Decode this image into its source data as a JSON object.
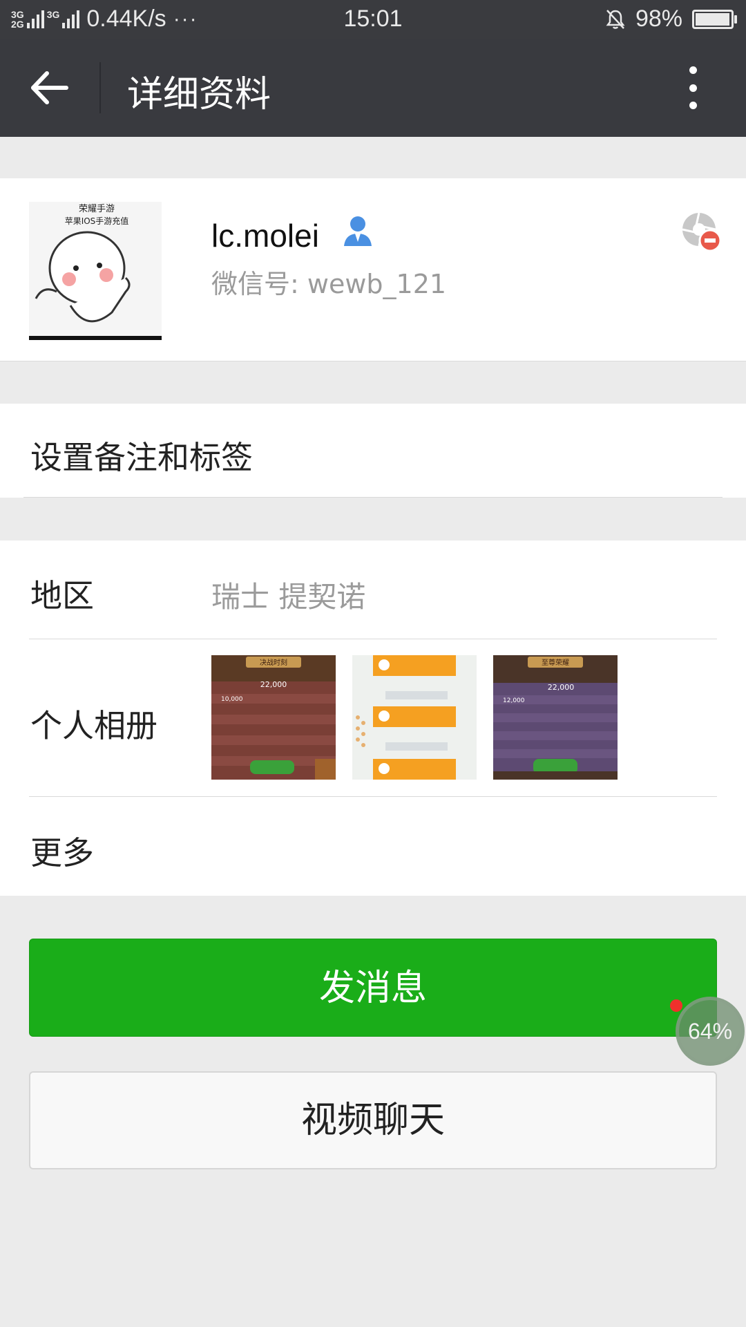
{
  "status_bar": {
    "network_top": "3G",
    "network_bottom": "2G",
    "network_top2": "3G",
    "speed": "0.44K/s",
    "more": "···",
    "time": "15:01",
    "battery_percent": "98%",
    "battery_level": 0.98
  },
  "header": {
    "title": "详细资料",
    "back_icon": "arrow-left-icon",
    "more_icon": "more-vertical-icon"
  },
  "profile": {
    "name": "lc.molei",
    "wechat_id": "微信号: wewb_121",
    "avatar_text_line1": "荣耀手游",
    "avatar_text_line2": "苹果IOS手游充值",
    "person_icon": "person-icon",
    "moments_icon": "moments-blocked-icon"
  },
  "remark": {
    "label": "设置备注和标签"
  },
  "info": {
    "region_label": "地区",
    "region_value": "瑞士  提契诺",
    "album_label": "个人相册",
    "more_label": "更多",
    "album": [
      {
        "title": "决战时刻",
        "value": "22,000",
        "row": "10,000"
      },
      {
        "title": "",
        "value": "",
        "row": ""
      },
      {
        "title": "至尊荣耀",
        "value": "22,000",
        "row": "12,000"
      }
    ]
  },
  "actions": {
    "send_message": "发消息",
    "video_chat": "视频聊天"
  },
  "floating": {
    "percent": "64%"
  },
  "colors": {
    "header_bg": "#393a3f",
    "primary_green": "#1aad19",
    "page_bg": "#ebebeb"
  }
}
